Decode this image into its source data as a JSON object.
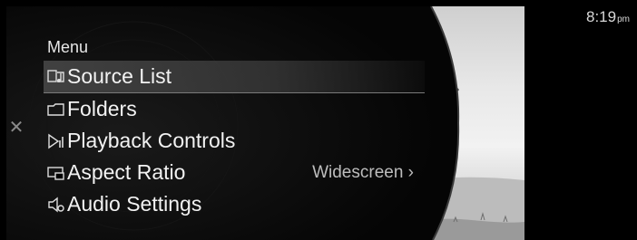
{
  "clock": {
    "time": "8:19",
    "ampm": "pm"
  },
  "menu": {
    "title": "Menu",
    "items": [
      {
        "label": "Source List",
        "icon": "source-list-icon",
        "selected": true
      },
      {
        "label": "Folders",
        "icon": "folder-icon"
      },
      {
        "label": "Playback Controls",
        "icon": "playback-controls-icon"
      },
      {
        "label": "Aspect Ratio",
        "icon": "aspect-ratio-icon",
        "value": "Widescreen ›"
      },
      {
        "label": "Audio Settings",
        "icon": "audio-settings-icon"
      }
    ]
  },
  "close": {
    "glyph": "✕",
    "icon": "close-icon"
  }
}
